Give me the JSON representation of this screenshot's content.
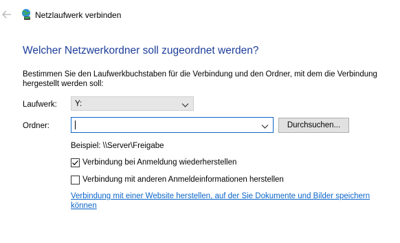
{
  "window": {
    "title": "Netzlaufwerk verbinden",
    "back_icon": "back-arrow-icon",
    "app_icon": "network-drive-icon"
  },
  "heading": "Welcher Netzwerkordner soll zugeordnet werden?",
  "instructions": "Bestimmen Sie den Laufwerkbuchstaben für die Verbindung und den Ordner, mit dem die Verbindung hergestellt werden soll:",
  "drive": {
    "label": "Laufwerk:",
    "value": "Y:"
  },
  "folder": {
    "label": "Ordner:",
    "value": "",
    "browse_label": "Durchsuchen..."
  },
  "example": "Beispiel: \\\\Server\\Freigabe",
  "options": {
    "reconnect": {
      "label": "Verbindung bei Anmeldung wiederherstellen",
      "checked": true
    },
    "other_credentials": {
      "label": "Verbindung mit anderen Anmeldeinformationen herstellen",
      "checked": false
    }
  },
  "link": "Verbindung mit einer Website herstellen, auf der Sie Dokumente und Bilder speichern können",
  "colors": {
    "heading": "#1c3d9a",
    "link": "#0a64c8",
    "focus_border": "#0a64c8",
    "button_bg": "#e1e1e1"
  }
}
